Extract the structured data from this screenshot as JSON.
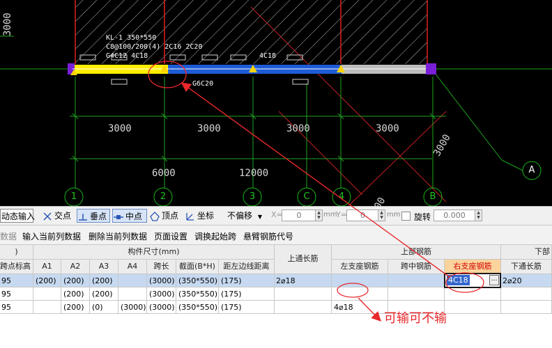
{
  "cad": {
    "beam_label_lines": [
      "KL-1 350*550",
      "C8@100/200(4) 2C16 2C20",
      "G4C12 4C18"
    ],
    "top_rebar_tag": "4C18",
    "bottom_tag": "G6C20",
    "left_dim": "3000",
    "span_dims": [
      "3000",
      "3000",
      "3000",
      "3000"
    ],
    "diag_dim": "3000",
    "total_dims": [
      "6000",
      "12000"
    ],
    "axis_numbers": [
      "1",
      "2",
      "3",
      "C",
      "4",
      "B"
    ],
    "axis_letter": "A",
    "partial_dim": "00",
    "colors": {
      "background": "#000000",
      "grid": "#1fa31f",
      "hatch": "#bbbbbb",
      "beam_yellow": "#ffee00",
      "beam_blue": "#1e5bd6",
      "beam_grey": "#bdbdbd",
      "wall_red": "#e02020",
      "column_purple": "#7a1fd8",
      "support_triangle": "#ffd400"
    }
  },
  "toolbar": {
    "dynamic_input": "动态输入",
    "intersection": "交点",
    "perpendicular": "垂点",
    "midpoint": "中点",
    "vertex": "顶点",
    "coordinate": "坐标",
    "offset_select": "不偏移",
    "x_label": "X=",
    "x_value": "0",
    "y_label": "Y=",
    "y_value": "0",
    "unit": "mm",
    "rotate_label": "旋转",
    "rotate_value": "0.000"
  },
  "menu": {
    "items": [
      "数据",
      "输入当前列数据",
      "删除当前列数据",
      "页面设置",
      "调换起始跨",
      "悬臂钢筋代号"
    ]
  },
  "table": {
    "group_headers": {
      "component_size": "构件尺寸(mm)",
      "top_rebar": "上部钢筋",
      "bottom_partial": "下部"
    },
    "top_through": "上通长筋",
    "columns": {
      "elevation": "跨点标高",
      "A1": "A1",
      "A2": "A2",
      "A3": "A3",
      "A4": "A4",
      "span": "跨长",
      "section": "截面(B*H)",
      "offset": "距左边线距离",
      "left_support": "左支座钢筋",
      "mid_span": "跨中钢筋",
      "right_support": "右支座钢筋",
      "bottom_through": "下通长筋"
    },
    "rows": [
      {
        "elev": "95",
        "A1": "(200)",
        "A2": "(200)",
        "A3": "(200)",
        "A4": "",
        "span": "(3000)",
        "section": "(350*550)",
        "offset": "(175)",
        "top_through": "2⌀18",
        "left_support": "",
        "mid_span": "",
        "right_support": "4C18",
        "bottom_through": "2⌀20"
      },
      {
        "elev": "95",
        "A1": "",
        "A2": "(200)",
        "A3": "(200)",
        "A4": "",
        "span": "(3000)",
        "section": "(350*550)",
        "offset": "(175)",
        "top_through": "",
        "left_support": "",
        "mid_span": "",
        "right_support": "",
        "bottom_through": ""
      },
      {
        "elev": "95",
        "A1": "",
        "A2": "(200)",
        "A3": "(0)",
        "A4": "(3000)",
        "span": "(3000)",
        "section": "(350*550)",
        "offset": "(175)",
        "top_through": "",
        "left_support": "4⌀18",
        "mid_span": "",
        "right_support": "",
        "bottom_through": ""
      }
    ],
    "editor_value": "4C18",
    "editor_button": "…"
  },
  "annotation": {
    "note": "可输可不输",
    "color": "#e8282b"
  }
}
